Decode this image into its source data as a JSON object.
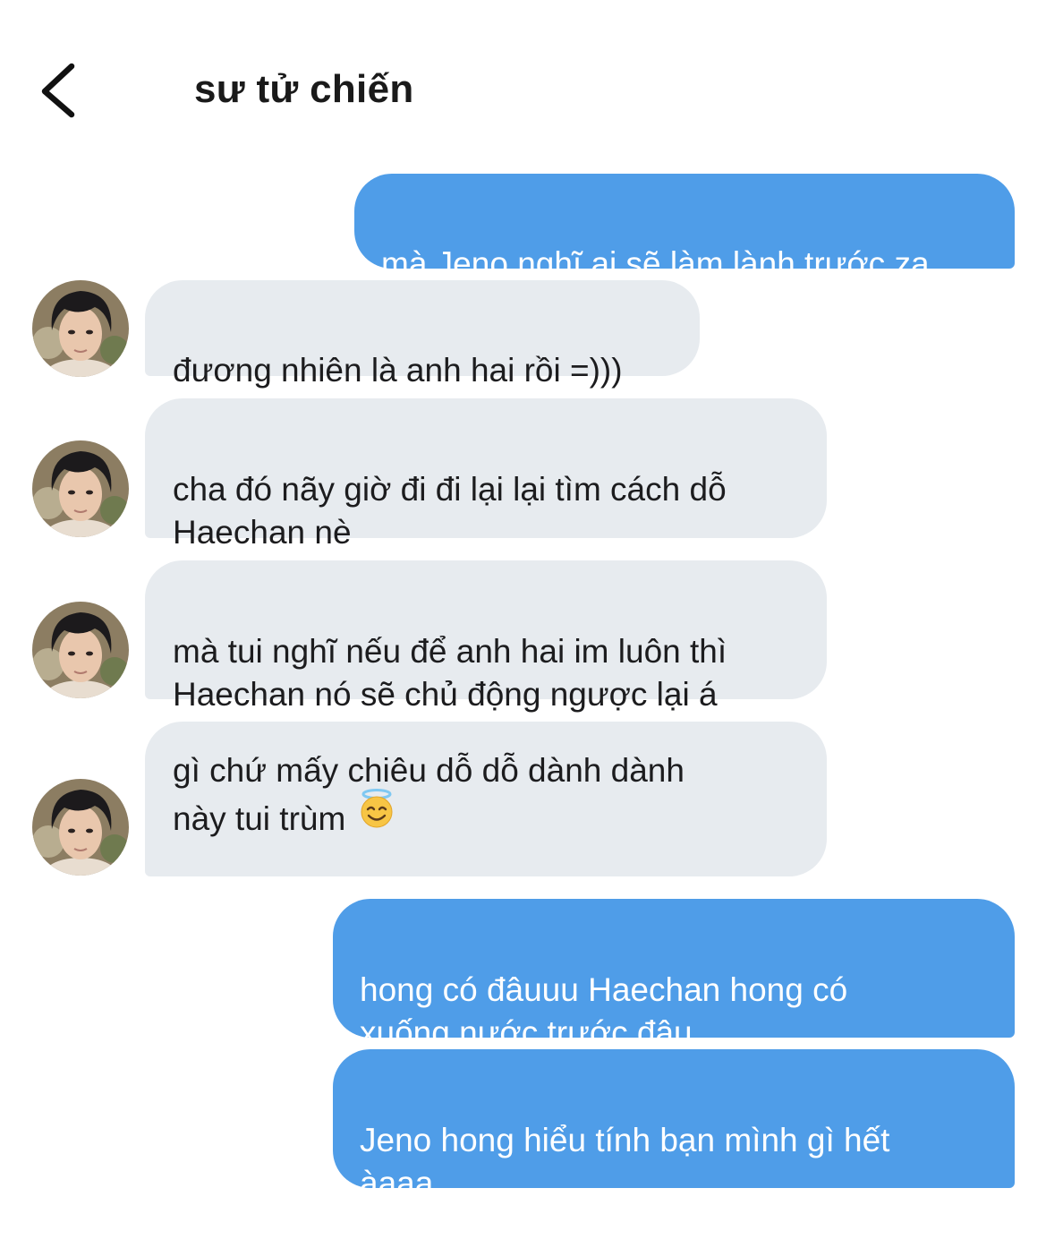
{
  "header": {
    "title": "sư tử chiến",
    "back_icon": "chevron-left-icon"
  },
  "messages": [
    {
      "side": "sent",
      "text": "mà Jeno nghĩ ai sẽ làm lành trước zạ"
    },
    {
      "side": "received",
      "text": "đương nhiên là anh hai rồi =)))"
    },
    {
      "side": "received",
      "text": "cha đó nãy giờ đi đi lại lại tìm cách dỗ\nHaechan nè"
    },
    {
      "side": "received",
      "text": "mà tui nghĩ nếu để anh hai im luôn thì\nHaechan nó sẽ chủ động ngược lại á"
    },
    {
      "side": "received",
      "text_line1": "gì chứ mấy chiêu dỗ dỗ dành dành",
      "text_line2": "này tui trùm",
      "emoji": "smiling-face-with-halo"
    },
    {
      "side": "sent",
      "text": "hong có đâuuu Haechan hong có\nxuống nước trước đâu"
    },
    {
      "side": "sent",
      "text": "Jeno hong hiểu tính bạn mình gì hết\nàaaa"
    }
  ],
  "colors": {
    "sent_bubble": "#4f9de8",
    "received_bubble": "#e7ebef",
    "background": "#ffffff"
  }
}
